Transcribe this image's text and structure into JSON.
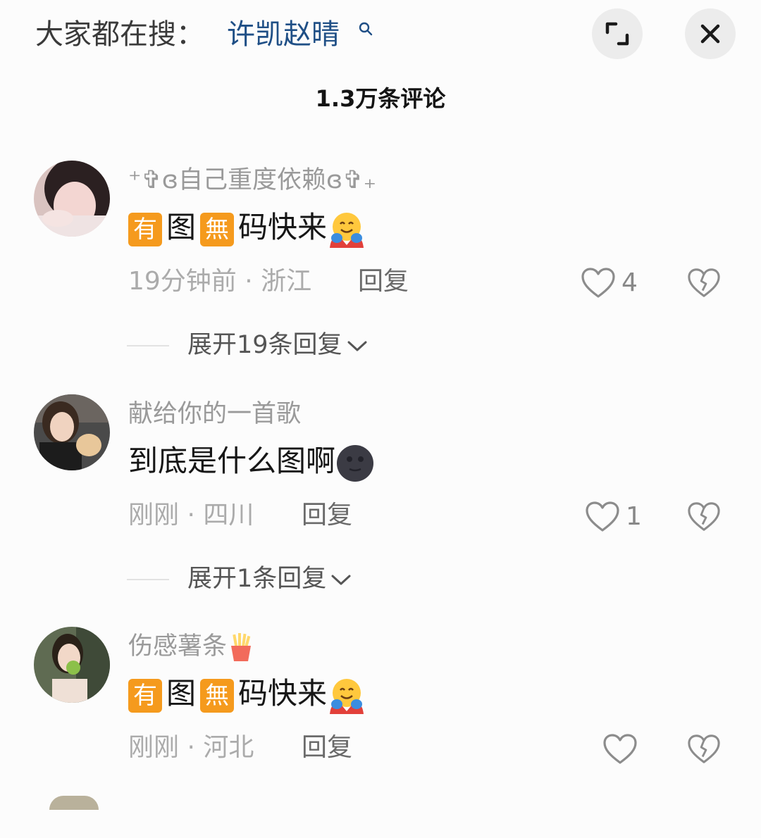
{
  "header": {
    "search_prefix": "大家都在搜：",
    "search_term": "许凯赵晴",
    "icons": {
      "search": "search-icon",
      "expand": "expand-icon",
      "close": "close-icon"
    }
  },
  "comment_count": "1.3万条评论",
  "comments": [
    {
      "username": "⁺✞ɞ自己重度依赖ɞ✞₊",
      "body": {
        "tag1": "有",
        "text1": "图",
        "tag2": "無",
        "text2": "码快来",
        "emoji": "hugging-face"
      },
      "meta": "19分钟前 · 浙江",
      "reply_label": "回复",
      "like_count": "4",
      "expand_label": "展开19条回复"
    },
    {
      "username": "献给你的一首歌",
      "body": {
        "text": "到底是什么图啊",
        "emoji": "new-moon-face"
      },
      "meta": "刚刚 · 四川",
      "reply_label": "回复",
      "like_count": "1",
      "expand_label": "展开1条回复"
    },
    {
      "username": "伤感薯条",
      "username_emoji": "french-fries",
      "body": {
        "tag1": "有",
        "text1": "图",
        "tag2": "無",
        "text2": "码快来",
        "emoji": "hugging-face"
      },
      "meta": "刚刚 · 河北",
      "reply_label": "回复",
      "like_count": ""
    }
  ],
  "colors": {
    "search_term": "#1f4f86",
    "tag": "#f59a1d",
    "muted": "#ababab"
  }
}
